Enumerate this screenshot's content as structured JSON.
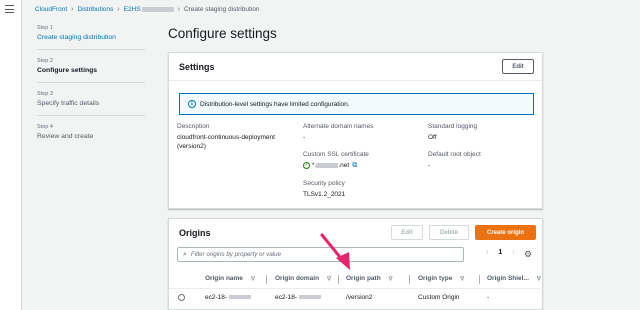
{
  "breadcrumb": {
    "items": [
      "CloudFront",
      "Distributions",
      "E2HS",
      "Create staging distribution"
    ]
  },
  "steps": [
    {
      "num": "Step 1",
      "title": "Create staging distribution"
    },
    {
      "num": "Step 2",
      "title": "Configure settings"
    },
    {
      "num": "Step 3",
      "title": "Specify traffic details"
    },
    {
      "num": "Step 4",
      "title": "Review and create"
    }
  ],
  "page_title": "Configure settings",
  "settings": {
    "title": "Settings",
    "edit_label": "Edit",
    "alert": "Distribution-level settings have limited configuration.",
    "description_label": "Description",
    "description_value": "cloudfront-continuous-deployment (version2)",
    "alt_domain_label": "Alternate domain names",
    "alt_domain_value": "-",
    "ssl_label": "Custom SSL certificate",
    "ssl_prefix": "*.",
    "ssl_suffix": ".net",
    "policy_label": "Security policy",
    "policy_value": "TLSv1.2_2021",
    "logging_label": "Standard logging",
    "logging_value": "Off",
    "root_label": "Default root object",
    "root_value": "-"
  },
  "origins": {
    "title": "Origins",
    "edit_label": "Edit",
    "delete_label": "Delete",
    "create_label": "Create origin",
    "filter_placeholder": "Filter origins by property or value",
    "page": "1",
    "columns": [
      "Origin name",
      "Origin domain",
      "Origin path",
      "Origin type",
      "Origin Shiel..."
    ],
    "row": {
      "name": "ec2-18-",
      "domain": "ec2-18-",
      "path": "/version2",
      "type": "Custom Origin",
      "shield": "-"
    }
  },
  "colors": {
    "link": "#0073bb",
    "primary": "#ec7211",
    "arrow": "#e8246f"
  },
  "icons": [
    "menu-icon",
    "info-icon",
    "check-circle-icon",
    "external-link-icon",
    "search-icon",
    "settings-gear-icon",
    "sort-icon"
  ]
}
